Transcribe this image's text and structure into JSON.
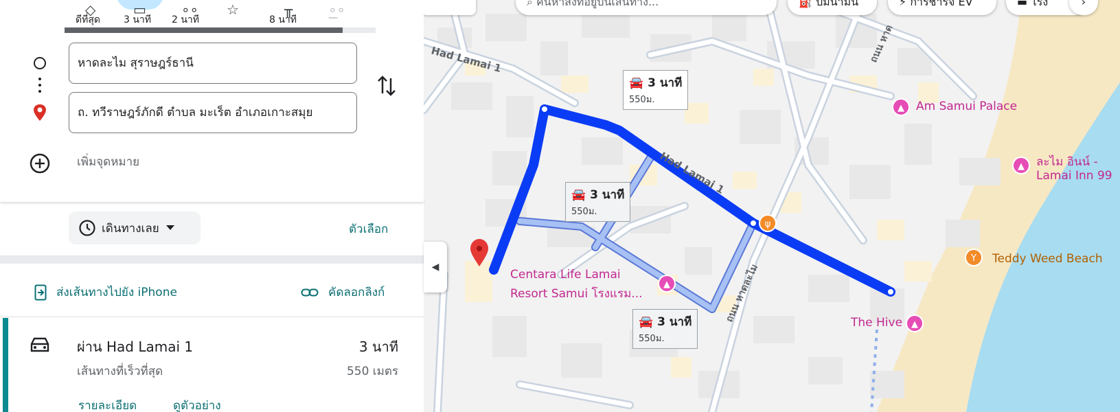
{
  "travel_modes": [
    {
      "icon": "best-route-icon",
      "label": "ดีที่สุด"
    },
    {
      "icon": "car-icon",
      "label": "3 นาที",
      "selected": true
    },
    {
      "icon": "motorbike-icon",
      "label": "2 นาที"
    },
    {
      "icon": "transit-icon",
      "label": ""
    },
    {
      "icon": "walk-icon",
      "label": "8 นาที"
    },
    {
      "icon": "bike-icon",
      "label": "—"
    }
  ],
  "origin": "หาดละไม สุราษฎร์ธานี",
  "destination": "ถ. ทวีราษฎร์ภักดี ตำบล มะเร็ต อำเภอเกาะสมุย",
  "add_destination": "เพิ่มจุดหมาย",
  "depart_label": "เดินทางเลย",
  "options_label": "ตัวเลือก",
  "send_to_phone": "ส่งเส้นทางไปยัง iPhone",
  "copy_link": "คัดลอกลิงก์",
  "route": {
    "title": "ผ่าน Had Lamai 1",
    "subtitle": "เส้นทางที่เร็วที่สุด",
    "time": "3 นาที",
    "distance": "550 เมตร",
    "details": "รายละเอียด",
    "preview": "ดูตัวอย่าง"
  },
  "map": {
    "search_placeholder": "ค้นหาสิ่งที่อยู่บนเส้นทาง...",
    "chip_gas": "ปั๊มน้ำมัน",
    "chip_ev": "การชาร์จ EV",
    "chip_hotel": "โรง",
    "streets": {
      "had_lamai_1_a": "Had Lamai 1",
      "had_lamai_1_b": "Had Lamai 1",
      "thanon_hat_lamai_a": "ถนน หาดละไม",
      "thanon_hat_lamai_b": "ถนน หาด"
    },
    "bubbles": [
      {
        "time": "3 นาที",
        "dist": "550ม.",
        "primary": true
      },
      {
        "time": "3 นาที",
        "dist": "550ม.",
        "primary": false
      },
      {
        "time": "3 นาที",
        "dist": "550ม.",
        "primary": false
      }
    ],
    "pois": {
      "am_samui": "Am Samui Palace",
      "lamai_inn_1": "ละไม อินน์ -",
      "lamai_inn_2": "Lamai Inn 99",
      "teddy": "Teddy Weed Beach",
      "hive": "The Hive",
      "centara_1": "Centara Life Lamai",
      "centara_2": "Resort Samui โรงแรม..."
    },
    "colors": {
      "primary_route": "#0b3cf5",
      "alt_route": "#a8c1f5",
      "sea": "#a8dcf0",
      "sand": "#f7e8c4",
      "poi_pink": "#e64cb5",
      "poi_orange": "#f28b28"
    }
  }
}
